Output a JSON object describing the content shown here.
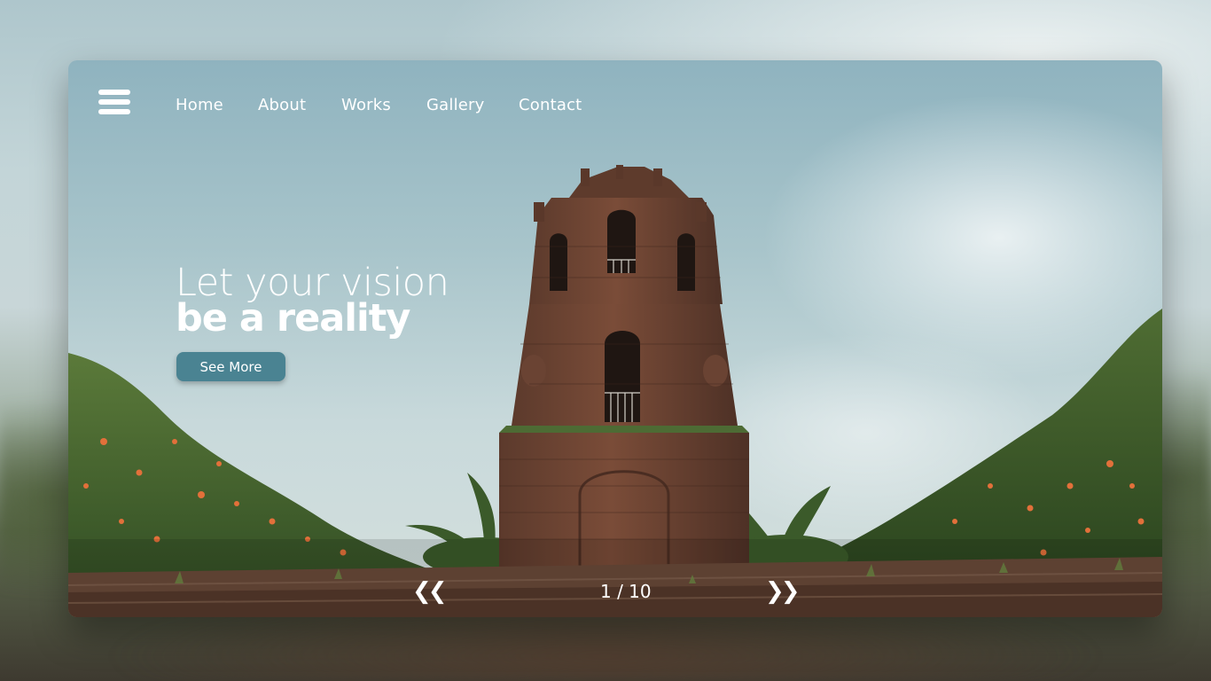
{
  "nav": {
    "items": [
      {
        "label": "Home"
      },
      {
        "label": "About"
      },
      {
        "label": "Works"
      },
      {
        "label": "Gallery"
      },
      {
        "label": "Contact"
      }
    ]
  },
  "menu_icon": "hamburger-menu-icon",
  "hero": {
    "line1": "Let your vision",
    "line2": "be a reality",
    "cta_label": "See More"
  },
  "pager": {
    "prev_icon": "double-chevron-left-icon",
    "next_icon": "double-chevron-right-icon",
    "current": "1",
    "total": "10",
    "label": "1 / 10"
  },
  "colors": {
    "accent": "#4a8392",
    "text": "#ffffff"
  }
}
